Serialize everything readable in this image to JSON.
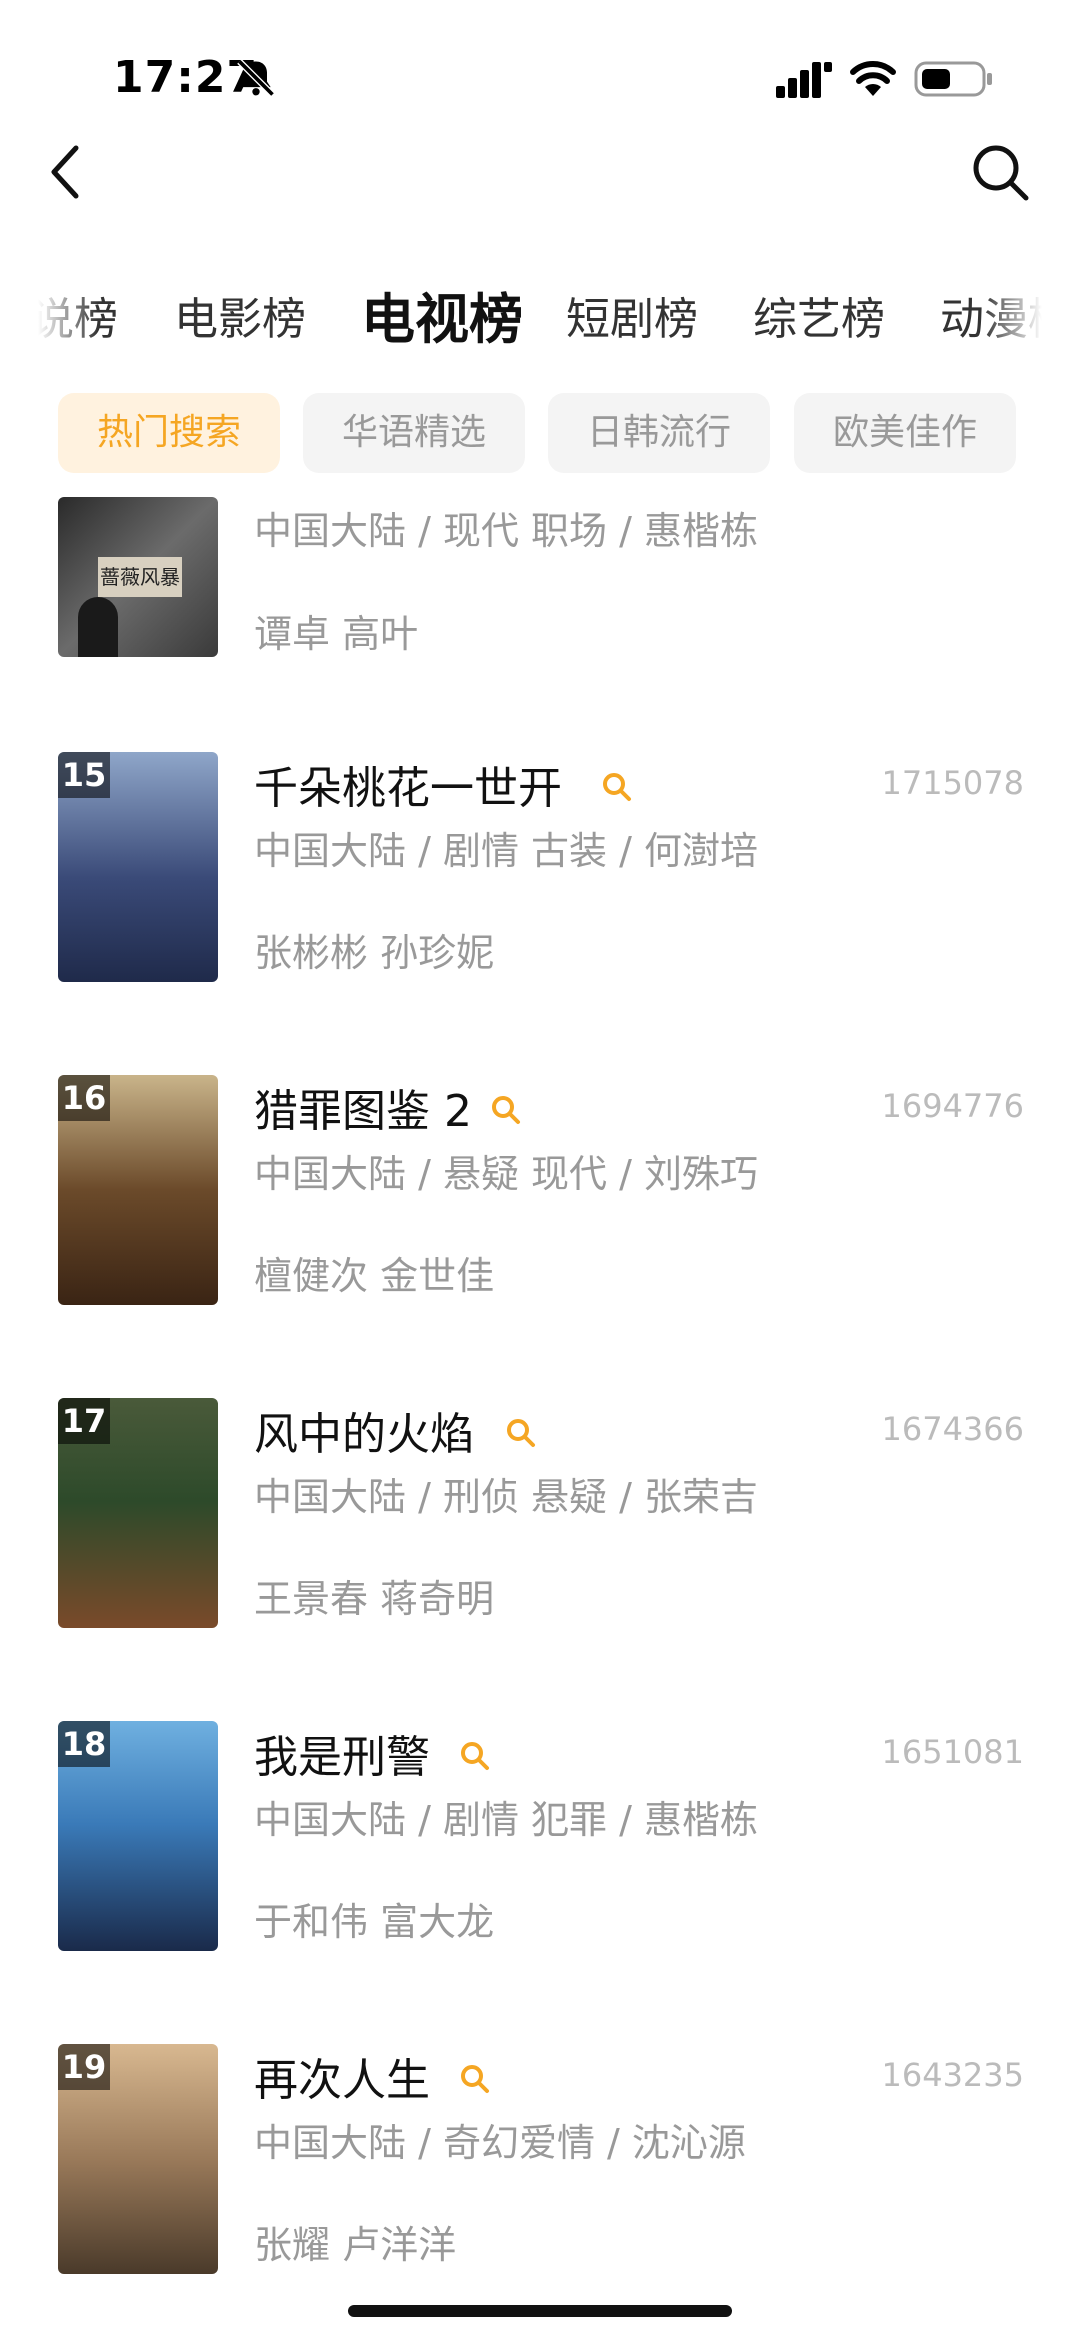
{
  "status_bar": {
    "time": "17:27"
  },
  "category_tabs": [
    "说榜",
    "电影榜",
    "电视榜",
    "短剧榜",
    "综艺榜",
    "动漫榜"
  ],
  "active_category": "电视榜",
  "filter_chips": [
    "热门搜索",
    "华语精选",
    "日韩流行",
    "欧美佳作"
  ],
  "active_chip": "热门搜索",
  "partial_item": {
    "poster_text": "蔷薇风暴",
    "meta": "中国大陆 / 现代 职场 / 惠楷栋",
    "cast": "谭卓 高叶"
  },
  "items": [
    {
      "rank": "15",
      "title": "千朵桃花一世开",
      "count": "1715078",
      "meta": "中国大陆 / 剧情 古装 / 何澍培",
      "cast": "张彬彬 孙珍妮"
    },
    {
      "rank": "16",
      "title": "猎罪图鉴 2",
      "count": "1694776",
      "meta": "中国大陆 / 悬疑 现代 / 刘殊巧",
      "cast": "檀健次 金世佳"
    },
    {
      "rank": "17",
      "title": "风中的火焰",
      "count": "1674366",
      "meta": "中国大陆 / 刑侦 悬疑 / 张荣吉",
      "cast": "王景春 蒋奇明"
    },
    {
      "rank": "18",
      "title": "我是刑警",
      "count": "1651081",
      "meta": "中国大陆 / 剧情 犯罪 / 惠楷栋",
      "cast": "于和伟 富大龙"
    },
    {
      "rank": "19",
      "title": "再次人生",
      "count": "1643235",
      "meta": "中国大陆 / 奇幻爱情 / 沈沁源",
      "cast": "张耀 卢洋洋"
    }
  ],
  "colors": {
    "accent": "#f5a623",
    "chip_active_bg": "#fff2df",
    "muted": "#999999"
  },
  "icons": [
    "back-arrow-icon",
    "search-icon",
    "bell-slash-icon",
    "signal-icon",
    "wifi-icon",
    "battery-icon"
  ]
}
